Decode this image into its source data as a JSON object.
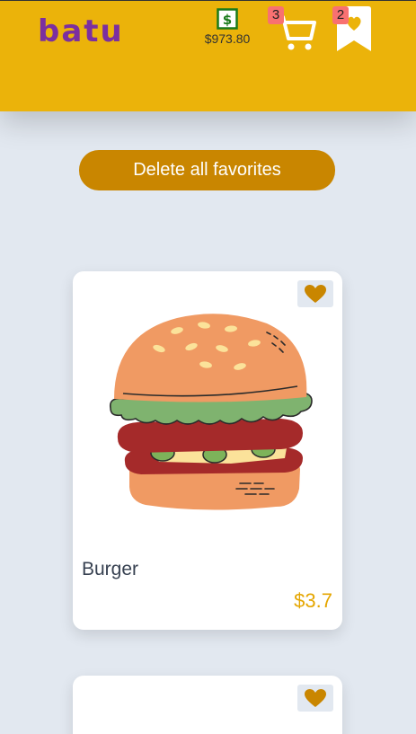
{
  "header": {
    "logo": "batu",
    "balance": "$973.80",
    "cart_count": "3",
    "favorites_count": "2"
  },
  "actions": {
    "delete_all_label": "Delete all favorites"
  },
  "products": [
    {
      "name": "Burger",
      "price": "$3.7",
      "favorited": true
    },
    {
      "name": "",
      "price": "",
      "favorited": true
    }
  ],
  "colors": {
    "header_bg": "#ebb30a",
    "logo": "#7b2fa0",
    "button_bg": "#c98600",
    "heart": "#c98600",
    "price": "#e5a600",
    "badge": "#f87171",
    "page_bg": "#e2e8f0"
  },
  "icons": [
    "wallet-icon",
    "cart-icon",
    "bookmark-heart-icon",
    "heart-icon"
  ]
}
